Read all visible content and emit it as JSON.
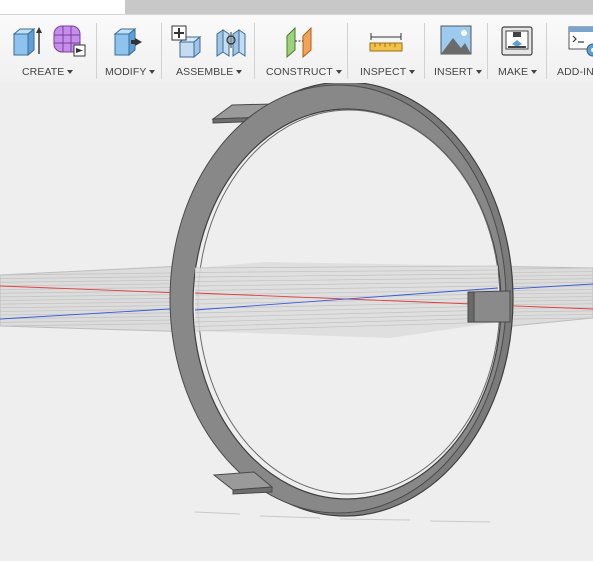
{
  "toolbar": {
    "groups": [
      {
        "label": "CREATE"
      },
      {
        "label": "MODIFY"
      },
      {
        "label": "ASSEMBLE"
      },
      {
        "label": "CONSTRUCT"
      },
      {
        "label": "INSPECT"
      },
      {
        "label": "INSERT"
      },
      {
        "label": "MAKE"
      },
      {
        "label": "ADD-IN"
      }
    ]
  },
  "icons": {
    "create_1": "extrude-box-icon",
    "create_2": "form-sphere-icon",
    "modify": "press-pull-icon",
    "assemble_1": "new-component-icon",
    "assemble_2": "joint-icon",
    "construct": "offset-plane-icon",
    "inspect": "measure-ruler-icon",
    "insert": "insert-image-icon",
    "make": "3d-print-icon",
    "addin": "scripts-addins-icon"
  },
  "colors": {
    "ring_fill": "#808080",
    "ring_edge": "#4a4a4a",
    "x_axis": "#e04040",
    "z_axis": "#3a5ad8",
    "grid": "#b8b8b8",
    "viewport_bg": "#eeeeee"
  }
}
